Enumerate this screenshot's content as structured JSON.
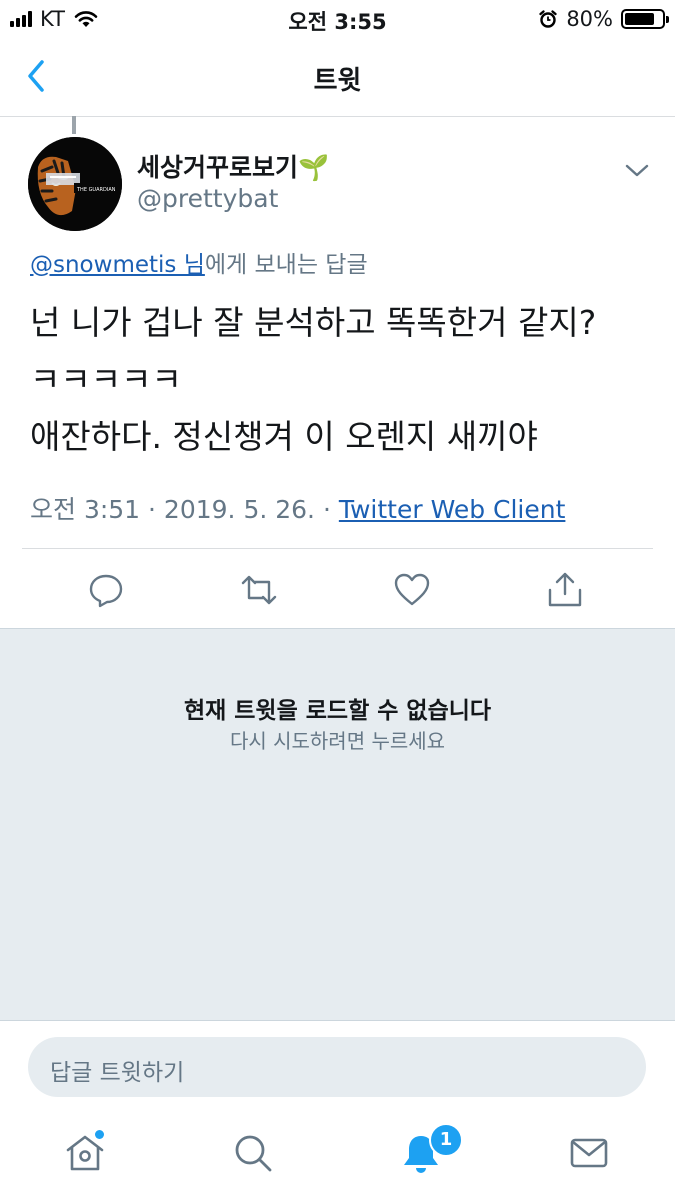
{
  "status_bar": {
    "carrier": "KT",
    "time": "오전 3:55",
    "battery": "80%"
  },
  "nav": {
    "title": "트윗"
  },
  "tweet": {
    "display_name": "세상거꾸로보기🌱",
    "handle": "@prettybat",
    "avatar_caption": "THE GUARDIAN",
    "reply_to_handle": "@snowmetis 님",
    "reply_to_suffix": "에게 보내는 답글",
    "text": "넌 니가 겁나 잘 분석하고 똑똑한거 같지?\nㅋㅋㅋㅋㅋ\n애잔하다. 정신챙겨 이 오렌지 새끼야",
    "meta_time_date": "오전 3:51 · 2019. 5. 26. · ",
    "client": "Twitter Web Client"
  },
  "error": {
    "title": "현재 트윗을 로드할 수 없습니다",
    "subtitle": "다시 시도하려면 누르세요"
  },
  "composer": {
    "placeholder": "답글 트윗하기"
  },
  "tabbar": {
    "notifications_badge": "1"
  },
  "icons": {
    "back": "chevron-left-icon",
    "more": "chevron-down-icon",
    "reply": "reply-icon",
    "retweet": "retweet-icon",
    "like": "heart-icon",
    "share": "share-icon",
    "home": "home-icon",
    "search": "search-icon",
    "notifications": "bell-icon",
    "messages": "mail-icon"
  },
  "colors": {
    "accent": "#1da1f2",
    "link": "#1b5fb3",
    "secondary_text": "#657786",
    "error_background": "#e6ecf0"
  },
  "battery_level": 0.8
}
